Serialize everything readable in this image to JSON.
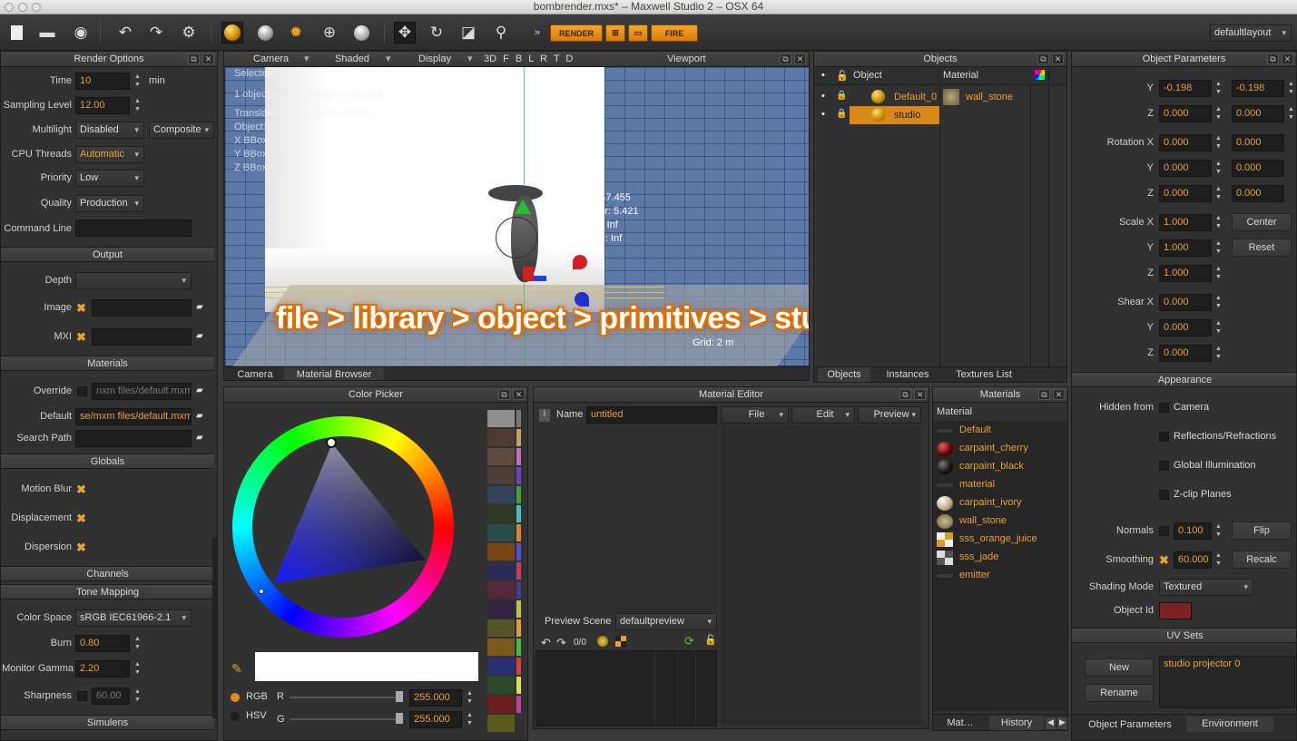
{
  "window": {
    "title": "bombrender.mxs* – Maxwell Studio 2 – OSX 64"
  },
  "toolbar": {
    "render_label": "RENDER",
    "fire_label": "FIRE",
    "layout": "defaultlayout"
  },
  "render_options": {
    "title": "Render Options",
    "time": {
      "label": "Time",
      "value": "10",
      "unit": "min"
    },
    "sampling": {
      "label": "Sampling Level",
      "value": "12.00"
    },
    "multilight": {
      "label": "Multilight",
      "value": "Disabled",
      "mode": "Composite"
    },
    "cpu": {
      "label": "CPU Threads",
      "value": "Automatic"
    },
    "priority": {
      "label": "Priority",
      "value": "Low"
    },
    "quality": {
      "label": "Quality",
      "value": "Production"
    },
    "command": {
      "label": "Command Line",
      "value": ""
    }
  },
  "output": {
    "title": "Output",
    "depth_label": "Depth",
    "image_label": "Image",
    "mxi_label": "MXI"
  },
  "materials_section": {
    "title": "Materials",
    "override_label": "Override",
    "override_value": "nxm files/default.mxm",
    "default_label": "Default",
    "default_value": "se/mxm files/default.mxm",
    "search_label": "Search Path"
  },
  "globals": {
    "title": "Globals",
    "motion_blur": "Motion Blur",
    "displacement": "Displacement",
    "dispersion": "Dispersion"
  },
  "channels": {
    "title": "Channels"
  },
  "tone": {
    "title": "Tone Mapping",
    "color_space_label": "Color Space",
    "color_space": "sRGB IEC61966-2.1",
    "burn_label": "Burn",
    "burn": "0.80",
    "gamma_label": "Monitor Gamma",
    "gamma": "2.20",
    "sharpness_label": "Sharpness",
    "sharpness": "60.00"
  },
  "simulens": {
    "title": "Simulens"
  },
  "viewport": {
    "title": "Viewport",
    "menu_camera": "Camera",
    "menu_shaded": "Shaded",
    "menu_display": "Display",
    "views": "3D F B L R T D",
    "info": [
      "Selected: 1",
      "1 objects share triangles selected",
      "Translated using World system",
      "Object: studio",
      "X BBox: 10",
      "Y BBox: 5",
      "Z BBox: 5"
    ],
    "camera_info": [
      "Fl: 47.455",
      "Near: 5.421",
      "Far: Inf",
      "DoF: Inf"
    ],
    "grid": "Grid: 2 m",
    "overlay": "file > library > object > primitives > studio"
  },
  "viewport_tabs": [
    "Camera",
    "Material Browser"
  ],
  "objects": {
    "title": "Objects",
    "col_object": "Object",
    "col_material": "Material",
    "rows": [
      {
        "name": "Default_0",
        "material": "wall_stone"
      },
      {
        "name": "studio",
        "material": ""
      }
    ],
    "tabs": [
      "Objects",
      "Instances",
      "Textures List"
    ]
  },
  "object_params": {
    "title": "Object Parameters",
    "y1": "-0.198",
    "y2": "-0.198",
    "z1": "0.000",
    "z2": "0.000",
    "rotation_label": "Rotation X",
    "rx1": "0.000",
    "rx2": "0.000",
    "ry1": "0.000",
    "ry2": "0.000",
    "rz1": "0.000",
    "rz2": "0.000",
    "scale_label": "Scale X",
    "sx": "1.000",
    "sy": "1.000",
    "sz": "1.000",
    "center": "Center",
    "reset": "Reset",
    "shear_label": "Shear X",
    "shx": "0.000",
    "shy": "0.000",
    "shz": "0.000",
    "y_label": "Y",
    "z_label": "Z",
    "appearance": "Appearance",
    "hidden_from": "Hidden from",
    "camera": "Camera",
    "reflections": "Reflections/Refractions",
    "gi": "Global Illumination",
    "zclip": "Z-clip Planes",
    "normals_label": "Normals",
    "normals": "0.100",
    "flip": "Flip",
    "smoothing_label": "Smoothing",
    "smoothing": "60.000",
    "recalc": "Recalc",
    "shading_label": "Shading Mode",
    "shading": "Textured",
    "objid_label": "Object Id",
    "objid_color": "#7b2222",
    "uvsets": "UV Sets",
    "new": "New",
    "rename": "Rename",
    "uv_item": "studio projector 0",
    "tabs": [
      "Object Parameters",
      "Environment"
    ]
  },
  "color_picker": {
    "title": "Color Picker",
    "rgb": "RGB",
    "hsv": "HSV",
    "r_label": "R",
    "g_label": "G",
    "r": "255.000",
    "g": "255.000"
  },
  "material_editor": {
    "title": "Material Editor",
    "name_label": "Name",
    "name": "untitled",
    "menu_file": "File",
    "menu_edit": "Edit",
    "menu_preview": "Preview",
    "preview_scene_label": "Preview Scene",
    "preview_scene": "defaultpreview",
    "counter": "0/0"
  },
  "materials_panel": {
    "title": "Materials",
    "header": "Material",
    "items": [
      "Default",
      "carpaint_cherry",
      "carpaint_black",
      "material",
      "carpaint_ivory",
      "wall_stone",
      "sss_orange_juice",
      "sss_jade",
      "emitter"
    ],
    "tabs": [
      "Mat…",
      "History"
    ]
  }
}
